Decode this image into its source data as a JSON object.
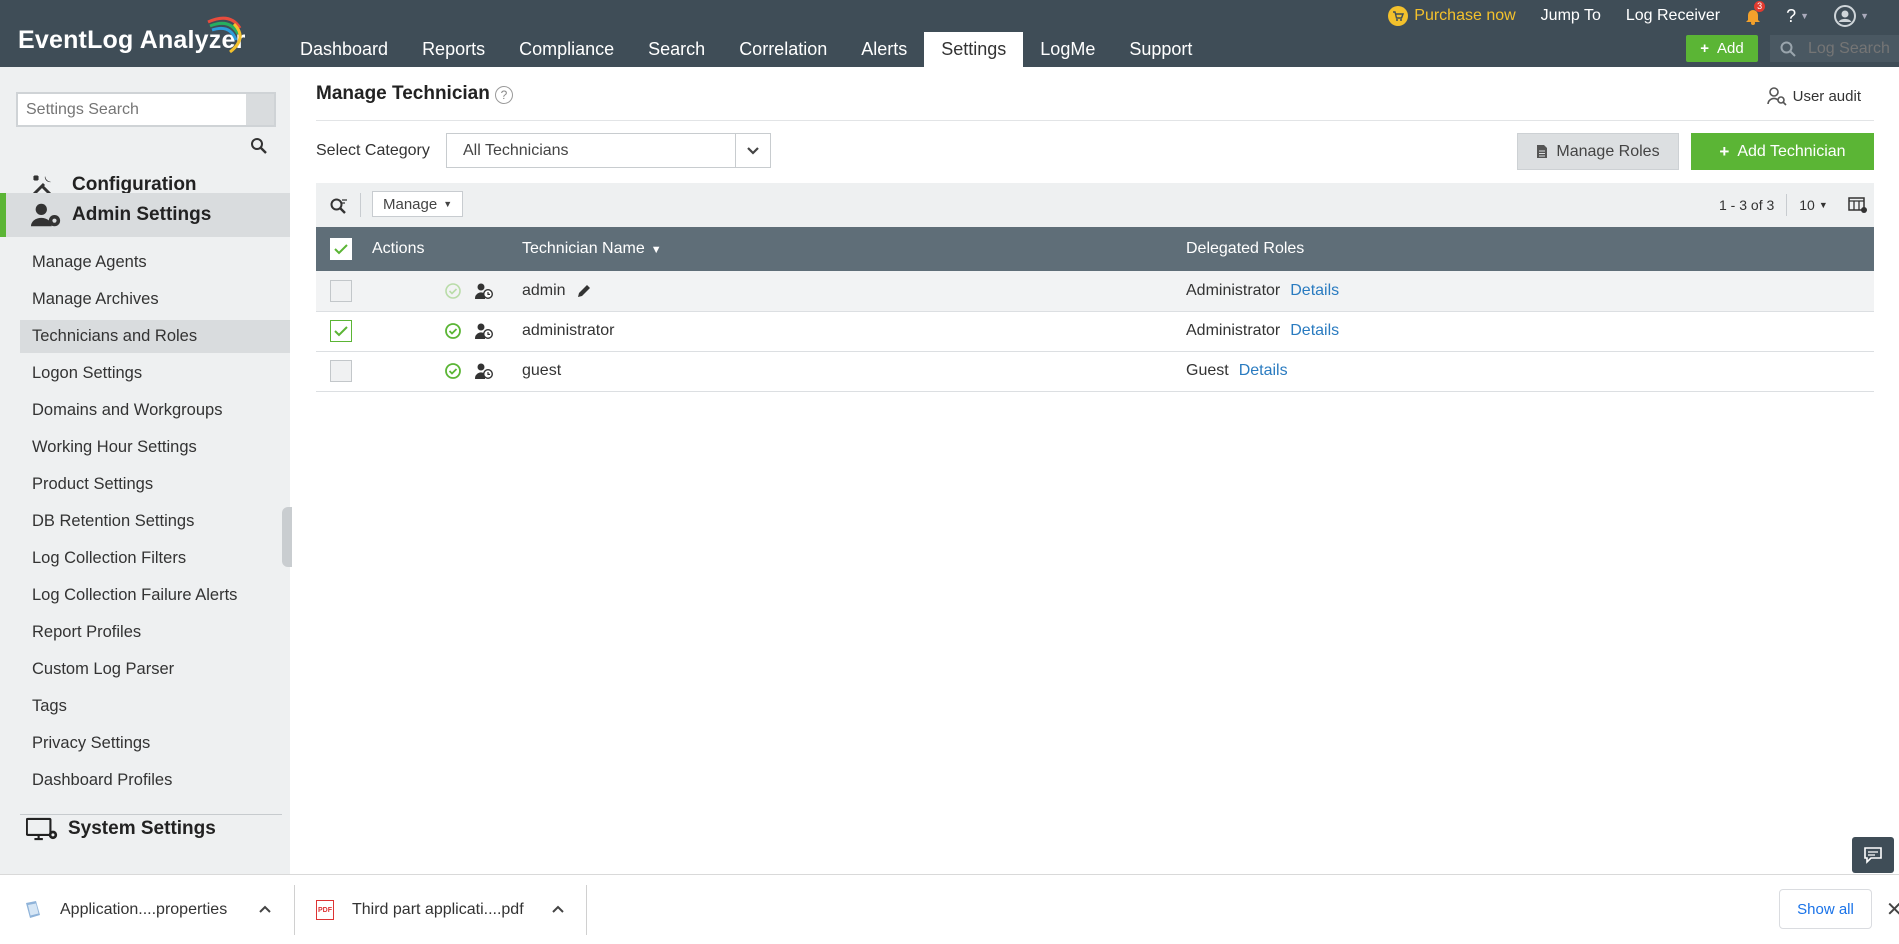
{
  "app": {
    "logo_text": "EventLog Analyzer"
  },
  "nav": {
    "tabs": [
      "Dashboard",
      "Reports",
      "Compliance",
      "Search",
      "Correlation",
      "Alerts",
      "Settings",
      "LogMe",
      "Support"
    ],
    "active": "Settings"
  },
  "toplinks": {
    "purchase": "Purchase now",
    "jump_to": "Jump To",
    "log_receiver": "Log Receiver",
    "notif_count": "3",
    "help": "?"
  },
  "header": {
    "add_label": "Add",
    "log_search_placeholder": "Log Search"
  },
  "sidebar": {
    "search_placeholder": "Settings Search",
    "sections": {
      "configuration": "Configuration",
      "admin": "Admin Settings",
      "system": "System Settings"
    },
    "items": [
      "Manage Agents",
      "Manage Archives",
      "Technicians and Roles",
      "Logon Settings",
      "Domains and Workgroups",
      "Working Hour Settings",
      "Product Settings",
      "DB Retention Settings",
      "Log Collection Filters",
      "Log Collection Failure Alerts",
      "Report Profiles",
      "Custom Log Parser",
      "Tags",
      "Privacy Settings",
      "Dashboard Profiles"
    ],
    "active_item": "Technicians and Roles"
  },
  "main": {
    "title": "Manage Technician",
    "user_audit": "User audit",
    "select_category_label": "Select Category",
    "select_category_value": "All Technicians",
    "manage_roles": "Manage Roles",
    "add_technician": "Add Technician",
    "manage_dropdown": "Manage",
    "pager_range": "1 - 3 of 3",
    "page_size": "10"
  },
  "table": {
    "columns": {
      "actions": "Actions",
      "name": "Technician Name",
      "roles": "Delegated Roles"
    },
    "rows": [
      {
        "name": "admin",
        "role": "Administrator",
        "details": "Details",
        "checked": false,
        "status_enabled": false
      },
      {
        "name": "administrator",
        "role": "Administrator",
        "details": "Details",
        "checked": true,
        "status_enabled": true
      },
      {
        "name": "guest",
        "role": "Guest",
        "details": "Details",
        "checked": false,
        "status_enabled": true
      }
    ]
  },
  "downloads": {
    "items": [
      {
        "name": "Application....properties"
      },
      {
        "name": "Third part applicati....pdf",
        "badge": "PDF"
      }
    ],
    "show_all": "Show all"
  },
  "colors": {
    "accent_green": "#5bb535",
    "header_bg": "#3f4d57",
    "purchase_yellow": "#f3c12c",
    "link_blue": "#2a7bc0"
  }
}
